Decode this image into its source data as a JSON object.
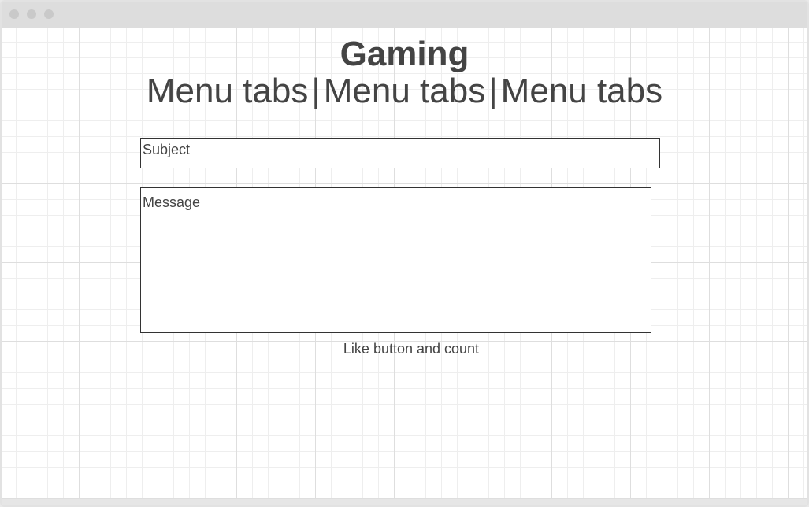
{
  "header": {
    "title": "Gaming",
    "menu_tabs": [
      "Menu tabs",
      "Menu tabs",
      "Menu tabs"
    ],
    "separator": "|"
  },
  "form": {
    "subject_placeholder": "Subject",
    "message_placeholder": "Message"
  },
  "footer": {
    "like_label": "Like button and count"
  }
}
